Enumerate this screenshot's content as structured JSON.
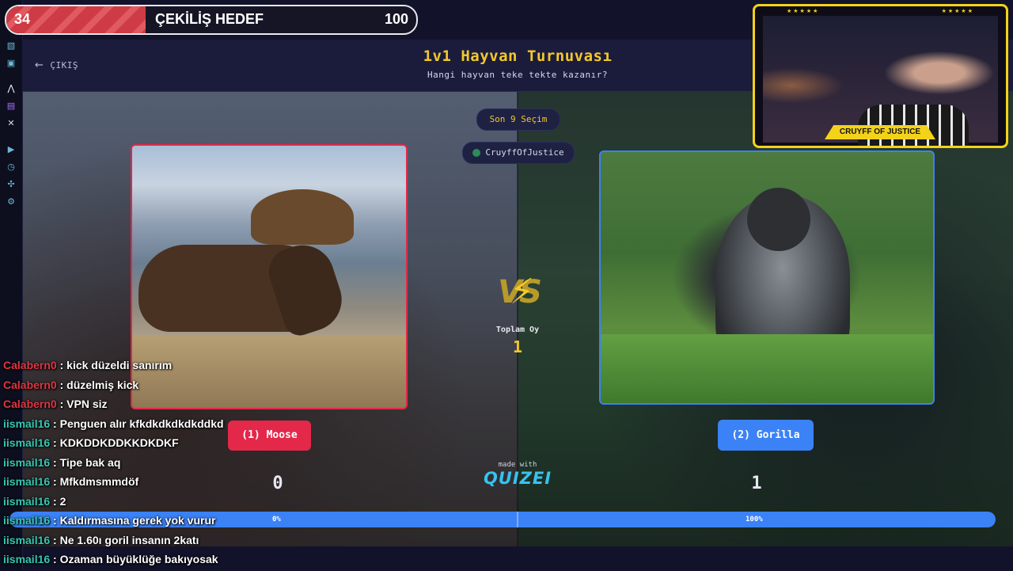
{
  "goal": {
    "current": "34",
    "title": "ÇEKİLİŞ HEDEF",
    "target": "100",
    "progress_fraction": 0.34
  },
  "url_bar": {
    "text": "tournament/quiz/67779df8c097041ba08796a4/play-on-stream"
  },
  "header": {
    "exit_label": "ÇIKIŞ",
    "title": "1v1 Hayvan Turnuvası",
    "subtitle": "Hangi hayvan teke tekte kazanır?"
  },
  "round": {
    "label": "Son 9 Seçim",
    "player": "CruyffOfJustice"
  },
  "options": {
    "left": {
      "label": "(1) Moose",
      "score": "0",
      "percent": "0%",
      "color": "#e4284a"
    },
    "right": {
      "label": "(2) Gorilla",
      "score": "1",
      "percent": "100%",
      "color": "#3b82f6"
    }
  },
  "vs": {
    "text": "VS",
    "total_label": "Toplam Oy",
    "total_value": "1"
  },
  "branding": {
    "made_with": "made with",
    "logo": "QUIZEI"
  },
  "votes": {
    "left_fraction": 0.0,
    "right_fraction": 1.0
  },
  "webcam": {
    "name": "CRUYFF OF JUSTICE",
    "stars": "★★★★★"
  },
  "chat": [
    {
      "user": "Calabern0",
      "message": "kick düzeldi sanırım",
      "color": "red"
    },
    {
      "user": "Calabern0",
      "message": "düzelmiş kick",
      "color": "red"
    },
    {
      "user": "Calabern0",
      "message": "VPN siz",
      "color": "red"
    },
    {
      "user": "iismail16",
      "message": "Penguen alır kfkdkdkdkdkddkd",
      "color": "teal"
    },
    {
      "user": "iismail16",
      "message": "KDKDDKDDKKDKDKF",
      "color": "teal"
    },
    {
      "user": "iismail16",
      "message": "Tipe bak aq",
      "color": "teal"
    },
    {
      "user": "iismail16",
      "message": "Mfkdmsmmdöf",
      "color": "teal"
    },
    {
      "user": "iismail16",
      "message": "2",
      "color": "teal"
    },
    {
      "user": "iismail16",
      "message": "Kaldırmasına gerek yok vurur",
      "color": "teal"
    },
    {
      "user": "iismail16",
      "message": "Ne 1.60ı goril insanın 2katı",
      "color": "teal"
    },
    {
      "user": "iismail16",
      "message": "Ozaman büyüklüğe bakıyosak",
      "color": "teal"
    }
  ],
  "sidebar_icons": [
    "sparkle-icon",
    "box-icon",
    "kick-icon",
    "twitch-icon",
    "x-icon",
    "play-icon",
    "clock-icon",
    "puzzle-icon",
    "settings-icon"
  ]
}
